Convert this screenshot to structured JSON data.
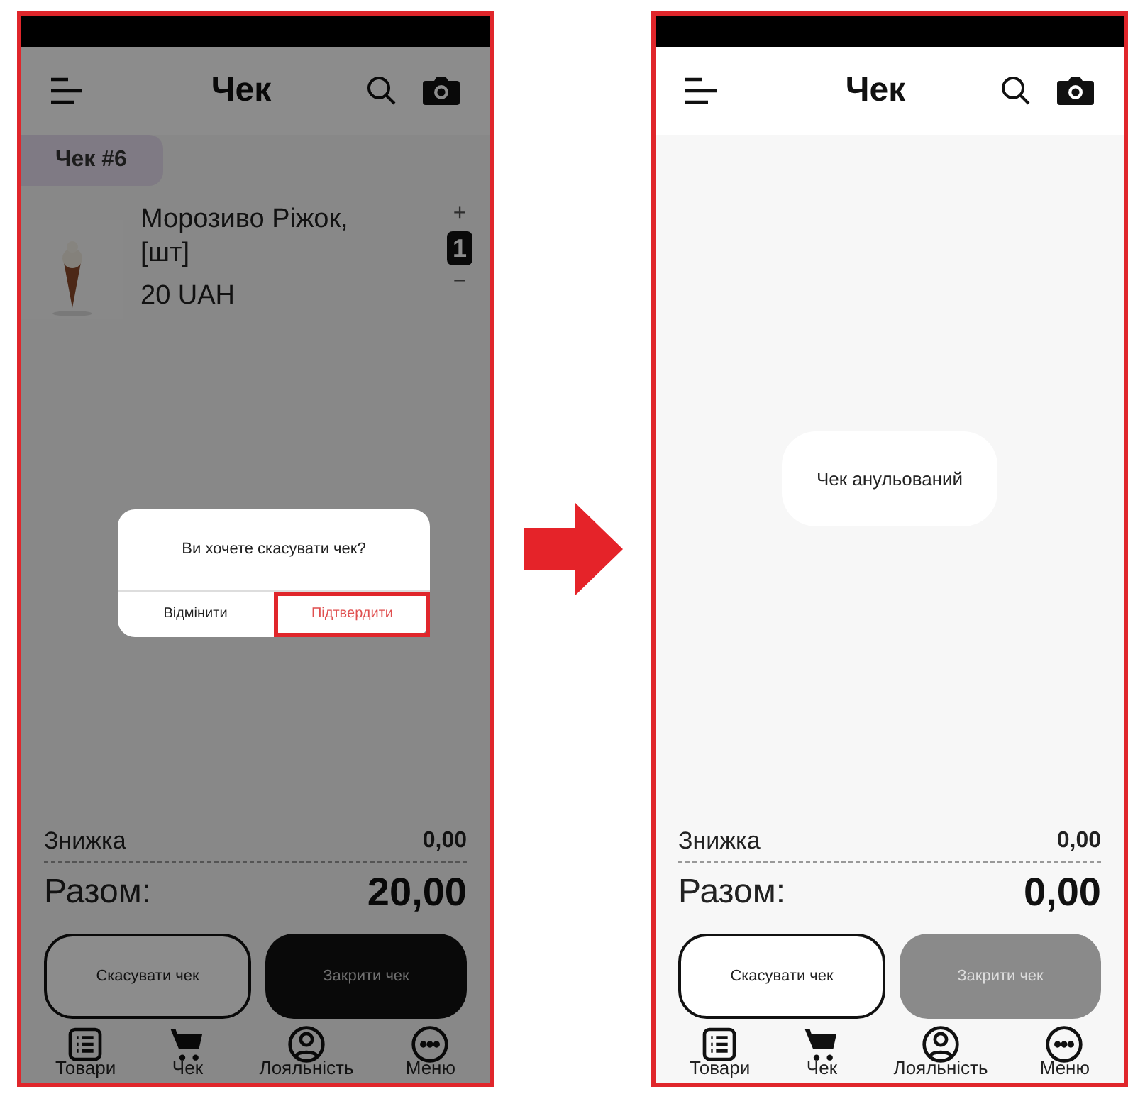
{
  "screens": [
    {
      "title": "Чек",
      "dimmed": true,
      "receipt_tab": "Чек #6",
      "items": [
        {
          "name": "Морозиво Ріжок, [шт]",
          "price": "20 UAH",
          "quantity": "1",
          "plus": "+",
          "minus": "−"
        }
      ],
      "dialog": {
        "message": "Ви хочете скасувати чек?",
        "buttons": [
          {
            "label": "Відмінити",
            "highlighted": false
          },
          {
            "label": "Підтвердити",
            "highlighted": true
          }
        ]
      },
      "discount_label": "Знижка",
      "discount": "0,00",
      "total_label": "Разом:",
      "total": "20,00",
      "cancel_button": "Скасувати чек",
      "close_button": {
        "label": "Закрити чек",
        "disabled": false
      },
      "nav": [
        {
          "label": "Товари"
        },
        {
          "label": "Чек"
        },
        {
          "label": "Лояльність"
        },
        {
          "label": "Меню"
        }
      ]
    },
    {
      "title": "Чек",
      "dimmed": false,
      "toast": "Чек анульований",
      "discount_label": "Знижка",
      "discount": "0,00",
      "total_label": "Разом:",
      "total": "0,00",
      "cancel_button": "Скасувати чек",
      "close_button": {
        "label": "Закрити чек",
        "disabled": true
      },
      "nav": [
        {
          "label": "Товари"
        },
        {
          "label": "Чек"
        },
        {
          "label": "Лояльність"
        },
        {
          "label": "Меню"
        }
      ]
    }
  ]
}
